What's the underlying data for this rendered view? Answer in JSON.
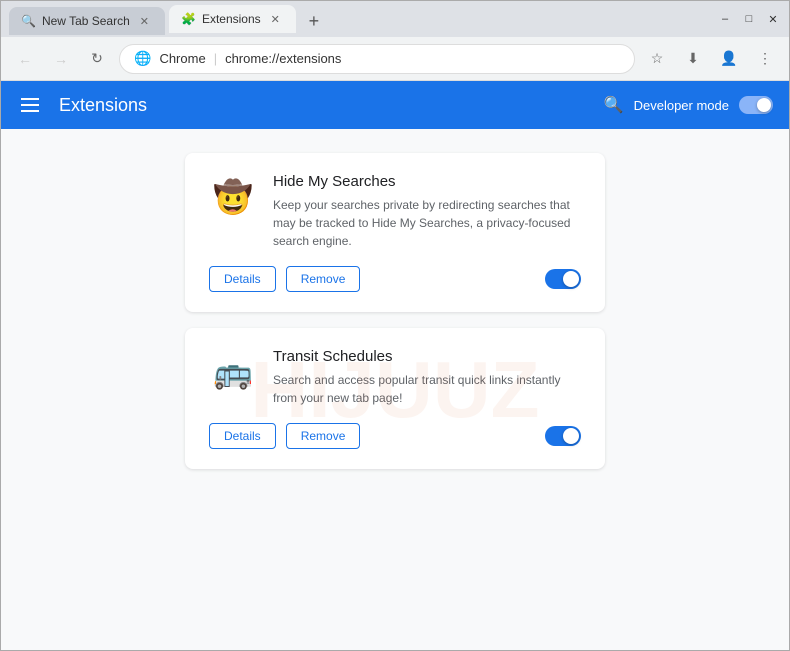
{
  "browser": {
    "tabs": [
      {
        "id": "tab1",
        "label": "New Tab Search",
        "icon": "🔍",
        "active": false,
        "closeable": true
      },
      {
        "id": "tab2",
        "label": "Extensions",
        "icon": "🧩",
        "active": true,
        "closeable": true
      }
    ],
    "new_tab_label": "+",
    "window_controls": {
      "minimize": "–",
      "maximize": "□",
      "close": "✕"
    },
    "address": {
      "chrome_icon": "🌐",
      "site": "Chrome",
      "separator": "|",
      "url": "chrome://extensions"
    },
    "toolbar": {
      "back": "←",
      "forward": "→",
      "refresh": "↻"
    }
  },
  "extensions_page": {
    "header": {
      "title": "Extensions",
      "search_label": "🔍",
      "dev_mode_label": "Developer mode"
    },
    "extensions": [
      {
        "id": "hide-my-searches",
        "name": "Hide My Searches",
        "description": "Keep your searches private by redirecting searches that may be tracked to Hide My Searches, a privacy-focused search engine.",
        "icon": "🤠",
        "details_label": "Details",
        "remove_label": "Remove",
        "enabled": true
      },
      {
        "id": "transit-schedules",
        "name": "Transit Schedules",
        "description": "Search and access popular transit quick links instantly from your new tab page!",
        "icon": "🚌",
        "details_label": "Details",
        "remove_label": "Remove",
        "enabled": true
      }
    ]
  }
}
